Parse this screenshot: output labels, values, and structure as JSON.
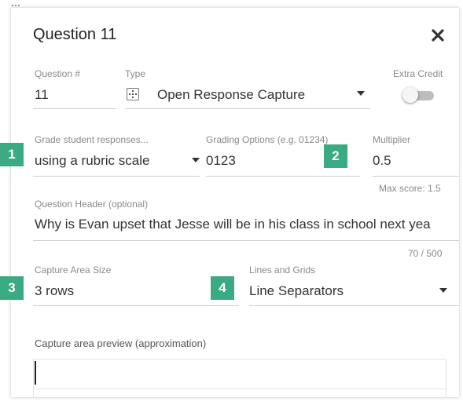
{
  "dialog": {
    "title": "Question 11"
  },
  "question_number": {
    "label": "Question #",
    "value": "11"
  },
  "type_field": {
    "label": "Type",
    "value": "Open Response Capture"
  },
  "extra_credit": {
    "label": "Extra Credit",
    "enabled": false
  },
  "grade_mode": {
    "label": "Grade student responses...",
    "value": "using a rubric scale"
  },
  "grading_options": {
    "label": "Grading Options (e.g. 01234)",
    "value": "0123"
  },
  "multiplier": {
    "label": "Multiplier",
    "value": "0.5",
    "max_score": "Max score: 1.5"
  },
  "question_header": {
    "label": "Question Header (optional)",
    "value": "Why is Evan upset that Jesse will be in his class in school next yea",
    "counter": "70 / 500"
  },
  "capture_area": {
    "label": "Capture Area Size",
    "value": "3 rows"
  },
  "lines_grids": {
    "label": "Lines and Grids",
    "value": "Line Separators"
  },
  "preview": {
    "label": "Capture area preview (approximation)"
  },
  "callouts": [
    "1",
    "2",
    "3",
    "4"
  ],
  "colors": {
    "callout": "#3aaa82",
    "underline": "#cfcfcf",
    "label": "#8a8a8a"
  },
  "icons": {
    "close": "close-icon",
    "type": "capture-icon",
    "handle": "drag-handle-icon"
  }
}
